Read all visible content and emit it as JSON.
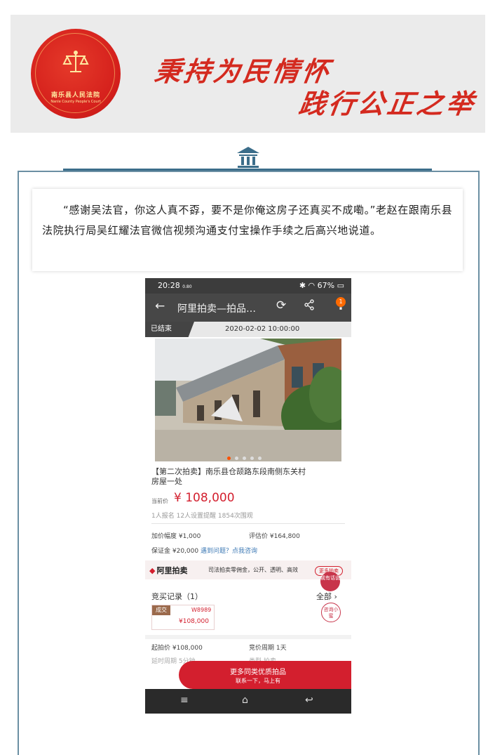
{
  "banner": {
    "emblem_name": "南乐县人民法院",
    "emblem_english": "Nanle County People's Court",
    "slogan_line1": "秉持为民情怀",
    "slogan_line2": "践行公正之举"
  },
  "article": {
    "quote": "“感谢吴法官，你这人真不孬，要不是你俺这房子还真买不成嘞。”老赵在跟南乐县法院执行局吴红耀法官微信视频沟通支付宝操作手续之后高兴地说道。"
  },
  "phone": {
    "status": {
      "time": "20:28",
      "speed": "0.80",
      "battery": "67%"
    },
    "appbar": {
      "back_icon": "←",
      "title": "阿里拍卖—拍品…",
      "refresh_icon": "⟳",
      "share_icon": "share",
      "more_icon": "⋮",
      "badge": "1"
    },
    "auction": {
      "status_tag": "已结束",
      "end_time": "2020-02-02 10:00:00",
      "title": "【第二次拍卖】南乐县仓颉路东段南侧东关村房屋一处",
      "price_label": "当前价",
      "price": "¥ 108,000",
      "meta": "1人报名  12人设置提醒  1854次围观",
      "increment": "加价幅度  ¥1,000",
      "appraisal": "评估价  ¥164,800",
      "deposit": "保证金  ¥20,000",
      "help_link": "遇到问题？点我咨询"
    },
    "ali_strip": {
      "logo_text": "阿里拍卖",
      "slogan": "司法拍卖零佣金，公开、透明、高效",
      "more_btn": "更多拍卖",
      "bubble1": "我有话说",
      "bubble2": "咨询小蜜"
    },
    "bids": {
      "title": "竞买记录（1）",
      "all_label": "全部",
      "deal_tag": "成交",
      "user": "W8989",
      "amount": "¥108,000"
    },
    "details": {
      "start_price": "起拍价  ¥108,000",
      "cycle": "竞价周期  1天",
      "partial_left": "延时周期  5分钟",
      "partial_right": "类型  拍卖"
    },
    "cta": {
      "line1": "更多同类优质拍品",
      "line2": "联系一下，马上有"
    },
    "nav": {
      "menu_icon": "≡",
      "home_icon": "⌂",
      "back_icon": "↩"
    }
  }
}
